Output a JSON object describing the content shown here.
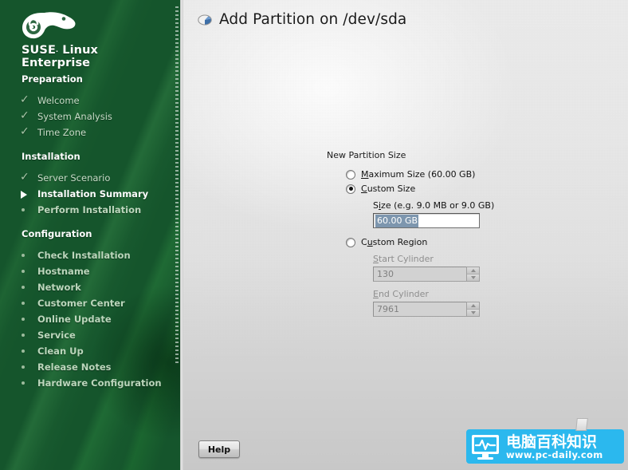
{
  "sidebar": {
    "brand_line1": "SUSE",
    "brand_reg": ".",
    "brand_line1b": " Linux",
    "brand_line2": "Enterprise",
    "sections": [
      {
        "title": "Preparation",
        "items": [
          {
            "label": "Welcome",
            "state": "done",
            "marker": "check-icon"
          },
          {
            "label": "System Analysis",
            "state": "done",
            "marker": "check-icon"
          },
          {
            "label": "Time Zone",
            "state": "done",
            "marker": "check-icon"
          }
        ]
      },
      {
        "title": "Installation",
        "items": [
          {
            "label": "Server Scenario",
            "state": "done",
            "marker": "check-icon"
          },
          {
            "label": "Installation Summary",
            "state": "current",
            "marker": "arrow-right-icon"
          },
          {
            "label": "Perform Installation",
            "state": "pending",
            "marker": "bullet-icon"
          }
        ]
      },
      {
        "title": "Configuration",
        "items": [
          {
            "label": "Check Installation",
            "state": "pending",
            "marker": "bullet-icon"
          },
          {
            "label": "Hostname",
            "state": "pending",
            "marker": "bullet-icon"
          },
          {
            "label": "Network",
            "state": "pending",
            "marker": "bullet-icon"
          },
          {
            "label": "Customer Center",
            "state": "pending",
            "marker": "bullet-icon"
          },
          {
            "label": "Online Update",
            "state": "pending",
            "marker": "bullet-icon"
          },
          {
            "label": "Service",
            "state": "pending",
            "marker": "bullet-icon"
          },
          {
            "label": "Clean Up",
            "state": "pending",
            "marker": "bullet-icon"
          },
          {
            "label": "Release Notes",
            "state": "pending",
            "marker": "bullet-icon"
          },
          {
            "label": "Hardware Configuration",
            "state": "pending",
            "marker": "bullet-icon"
          }
        ]
      }
    ]
  },
  "header": {
    "title": "Add Partition on /dev/sda",
    "icon": "partition-disk-icon"
  },
  "form": {
    "group_label": "New Partition Size",
    "maximum_size": {
      "label_pre": "M",
      "label_mnemonic": "M",
      "label_rest": "aximum Size (60.00 GB)",
      "full_label": "Maximum Size (60.00 GB)",
      "selected": false
    },
    "custom_size": {
      "label_mnemonic": "C",
      "label_rest": "ustom Size",
      "full_label": "Custom Size",
      "selected": true
    },
    "size_field": {
      "label_pre": "S",
      "label_mnemonic": "i",
      "label_rest": "ze (e.g. 9.0 MB or 9.0 GB)",
      "full_label": "Size (e.g. 9.0 MB or 9.0 GB)",
      "value": "60.00 GB",
      "selected_text": true,
      "enabled": true
    },
    "custom_region": {
      "label_pre": "C",
      "label_mnemonic": "u",
      "label_rest": "stom Region",
      "full_label": "Custom Region",
      "selected": false
    },
    "start_cylinder": {
      "label_mnemonic": "S",
      "label_rest": "tart Cylinder",
      "full_label": "Start Cylinder",
      "value": "130",
      "enabled": false
    },
    "end_cylinder": {
      "label_mnemonic": "E",
      "label_rest": "nd Cylinder",
      "full_label": "End Cylinder",
      "value": "7961",
      "enabled": false
    }
  },
  "buttons": {
    "help": "Help"
  },
  "watermark": {
    "chinese": "电脑百科知识",
    "url": "www.pc-daily.com",
    "icon": "monitor-pulse-icon",
    "color": "#2bb8ee"
  },
  "colors": {
    "sidebar_green": "#15552c",
    "panel_gray": "#e2e2e2",
    "selection_blue": "#7d96ae",
    "accent_cyan": "#2bb8ee"
  }
}
